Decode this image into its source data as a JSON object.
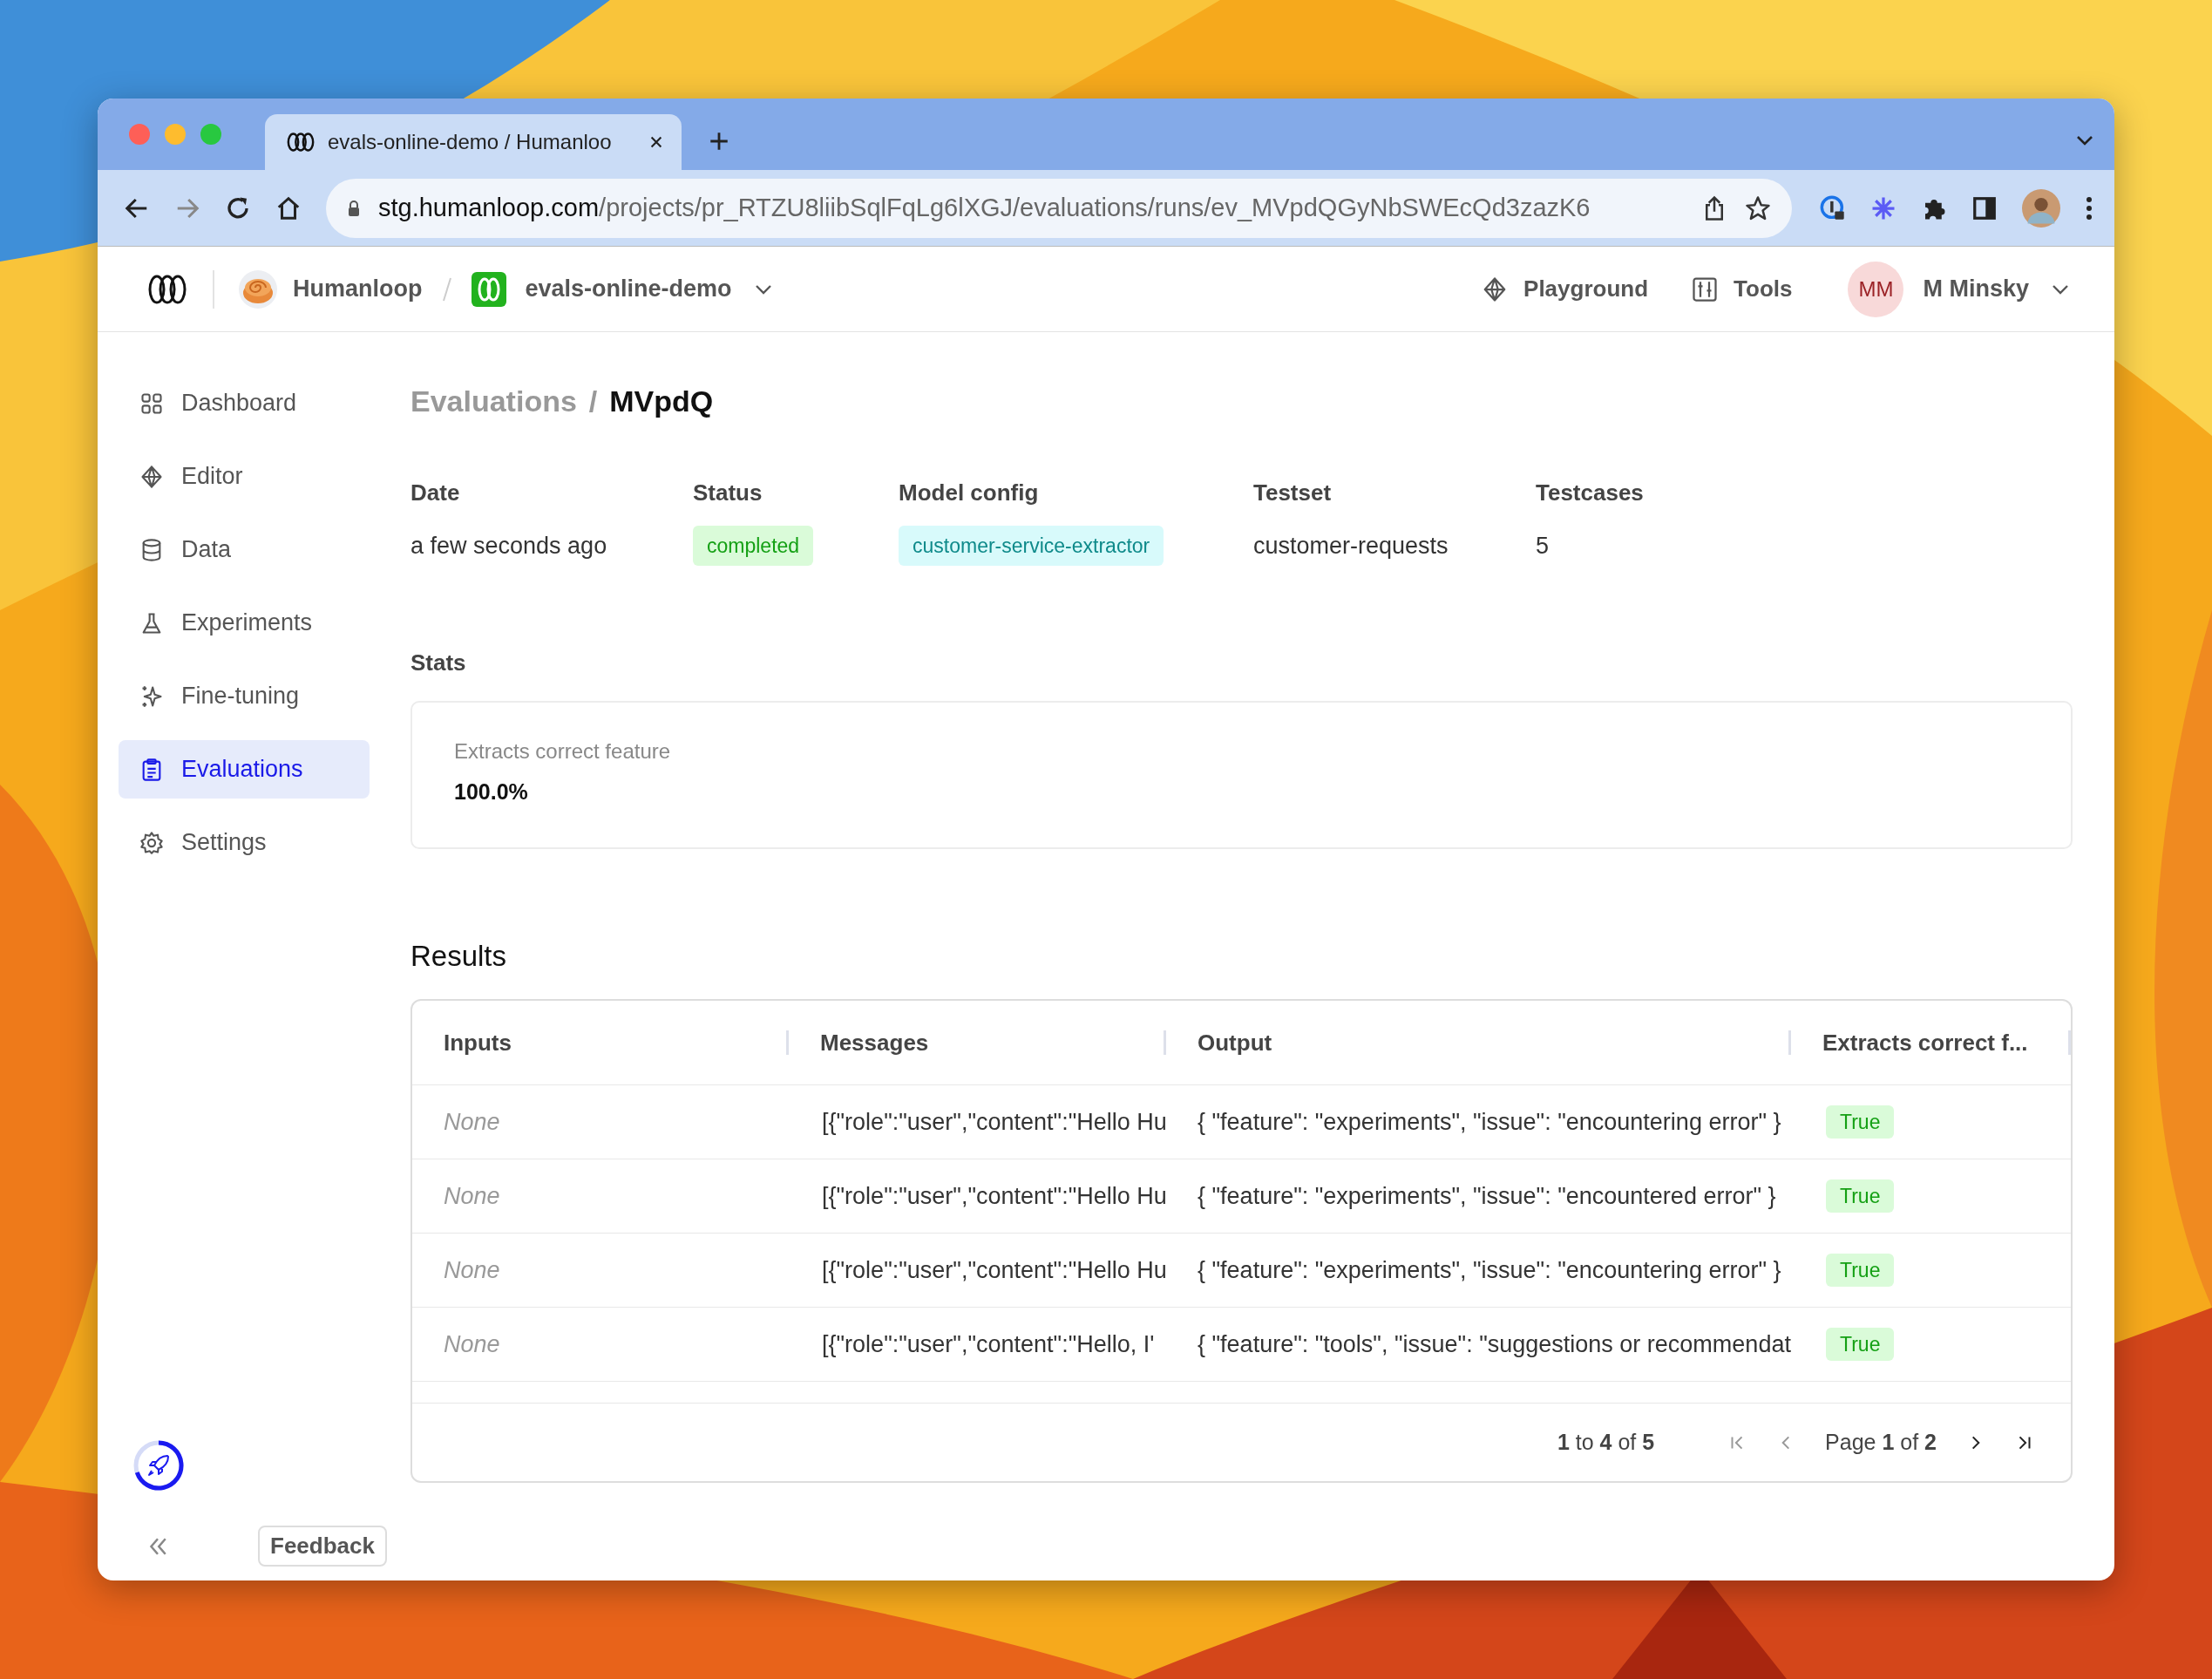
{
  "browser": {
    "tab": {
      "title": "evals-online-demo / Humanloo"
    },
    "url": {
      "host": "stg.humanloop.com",
      "path": "/projects/pr_RTZU8liibSqlFqLg6lXGJ/evaluations/runs/ev_MVpdQGyNbSWEcQd3zazK6"
    }
  },
  "app_header": {
    "org": "Humanloop",
    "project": "evals-online-demo",
    "nav": [
      {
        "label": "Playground"
      },
      {
        "label": "Tools"
      }
    ],
    "user": {
      "initials": "MM",
      "name": "M Minsky"
    }
  },
  "sidebar": {
    "items": [
      {
        "label": "Dashboard",
        "selected": false
      },
      {
        "label": "Editor",
        "selected": false
      },
      {
        "label": "Data",
        "selected": false
      },
      {
        "label": "Experiments",
        "selected": false
      },
      {
        "label": "Fine-tuning",
        "selected": false
      },
      {
        "label": "Evaluations",
        "selected": true
      },
      {
        "label": "Settings",
        "selected": false
      }
    ],
    "feedback": "Feedback"
  },
  "breadcrumb": [
    "Evaluations",
    "/",
    "MVpdQ"
  ],
  "summary": [
    {
      "label": "Date",
      "value": "a few seconds ago",
      "kind": "text"
    },
    {
      "label": "Status",
      "value": "completed",
      "kind": "status"
    },
    {
      "label": "Model config",
      "value": "customer-service-extractor",
      "kind": "config"
    },
    {
      "label": "Testset",
      "value": "customer-requests",
      "kind": "text"
    },
    {
      "label": "Testcases",
      "value": "5",
      "kind": "text"
    }
  ],
  "stats": {
    "title": "Stats",
    "items": [
      {
        "label": "Extracts correct feature",
        "value": "100.0%"
      }
    ]
  },
  "results": {
    "title": "Results",
    "columns": [
      "Inputs",
      "Messages",
      "Output",
      "Extracts correct f..."
    ],
    "rows": [
      {
        "inputs": "None",
        "messages": "[{\"role\":\"user\",\"content\":\"Hello Hu",
        "output": "{ \"feature\": \"experiments\", \"issue\": \"encountering error\" }",
        "result": "True"
      },
      {
        "inputs": "None",
        "messages": "[{\"role\":\"user\",\"content\":\"Hello Hu",
        "output": "{ \"feature\": \"experiments\", \"issue\": \"encountered error\" }",
        "result": "True"
      },
      {
        "inputs": "None",
        "messages": "[{\"role\":\"user\",\"content\":\"Hello Hu",
        "output": "{ \"feature\": \"experiments\", \"issue\": \"encountering error\" }",
        "result": "True"
      },
      {
        "inputs": "None",
        "messages": "[{\"role\":\"user\",\"content\":\"Hello, I'",
        "output": "{ \"feature\": \"tools\", \"issue\": \"suggestions or recommendat",
        "result": "True"
      }
    ],
    "pagination": {
      "range": "**1** to **4** of **5**",
      "page": "Page **1** of **2**"
    }
  }
}
